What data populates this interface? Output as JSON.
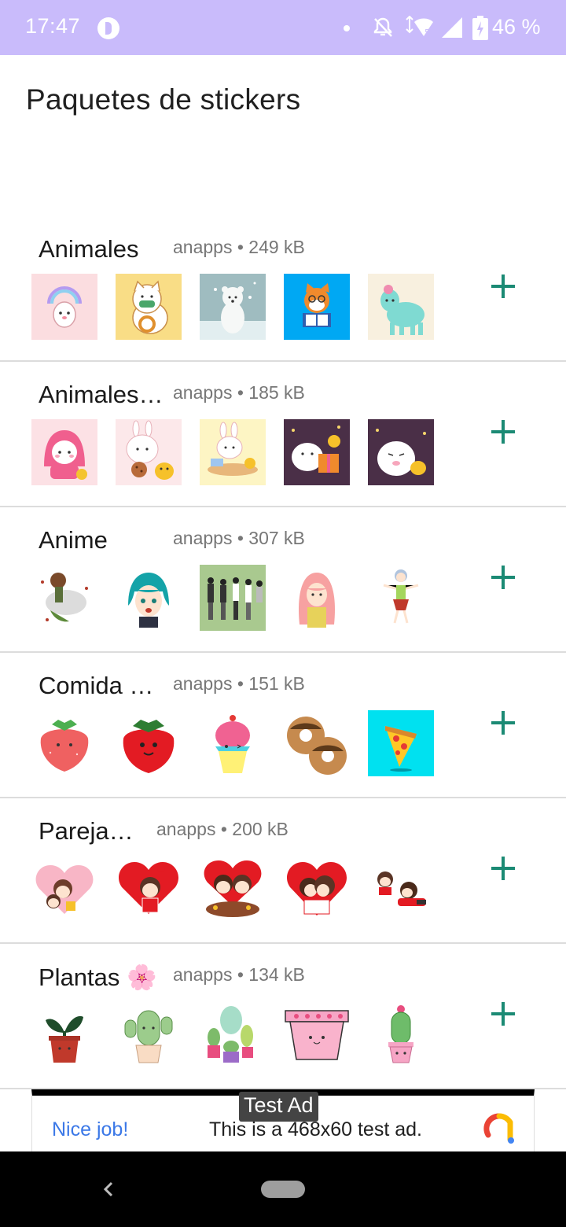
{
  "status_bar": {
    "time": "17:47",
    "battery_text": "46 %",
    "icons": [
      "p-icon",
      "notification-dot",
      "bell-off-icon",
      "wifi-icon",
      "signal-icon",
      "battery-icon"
    ]
  },
  "page_title": "Paquetes de stickers",
  "packs": [
    {
      "name": "Animales",
      "meta": "anapps • 249 kB",
      "stickers": [
        "rainbow-bunny",
        "lucky-cat-mask",
        "polar-bear",
        "fox-reading",
        "alpaca"
      ],
      "add_icon": "plus-icon"
    },
    {
      "name": "Animales…",
      "meta": "anapps • 185 kB",
      "stickers": [
        "pink-hood-bunny",
        "bunny-cookie",
        "bunny-desk",
        "bear-gift",
        "bear-chick"
      ],
      "add_icon": "plus-icon"
    },
    {
      "name": "Anime",
      "meta": "anapps • 307 kB",
      "stickers": [
        "anime-creature",
        "teal-hair-girl",
        "anime-group",
        "pink-hair-girl",
        "dancing-girl"
      ],
      "add_icon": "plus-icon"
    },
    {
      "name": "Comida …",
      "meta": "anapps • 151 kB",
      "stickers": [
        "strawberry-pink",
        "strawberry-red",
        "cupcake",
        "donuts",
        "pizza"
      ],
      "add_icon": "plus-icon"
    },
    {
      "name": "Pareja…",
      "meta": "anapps • 200 kB",
      "stickers": [
        "heart-couple-1",
        "heart-couple-2",
        "heart-couple-3",
        "heart-couple-kiss",
        "couple-lying"
      ],
      "add_icon": "plus-icon"
    },
    {
      "name": "Plantas 🌸",
      "meta": "anapps • 134 kB",
      "stickers": [
        "sprout-pot",
        "cactus-happy",
        "cactus-group",
        "pink-pot",
        "cactus-pink-pot"
      ],
      "add_icon": "plus-icon"
    }
  ],
  "ad": {
    "label": "Test Ad",
    "nice": "Nice job!",
    "text": "This is a 468x60 test ad."
  },
  "colors": {
    "status_bar": "#c9bbfb",
    "add_button": "#1b8a74",
    "divider": "#dcdcdc",
    "ad_link": "#3b78e7"
  }
}
